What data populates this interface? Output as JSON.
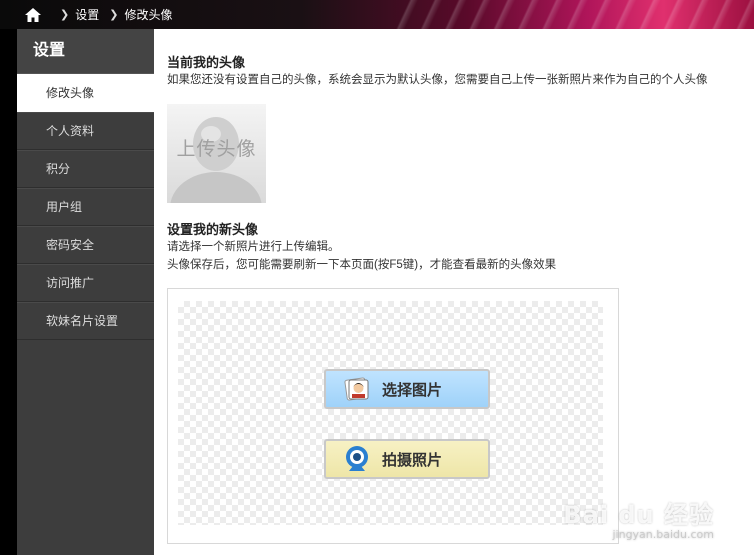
{
  "breadcrumb": {
    "items": [
      "设置",
      "修改头像"
    ]
  },
  "sidebar": {
    "title": "设置",
    "items": [
      {
        "label": "修改头像",
        "active": true
      },
      {
        "label": "个人资料",
        "active": false
      },
      {
        "label": "积分",
        "active": false
      },
      {
        "label": "用户组",
        "active": false
      },
      {
        "label": "密码安全",
        "active": false
      },
      {
        "label": "访问推广",
        "active": false
      },
      {
        "label": "软妹名片设置",
        "active": false
      }
    ]
  },
  "current_avatar": {
    "heading": "当前我的头像",
    "description": "如果您还没有设置自己的头像，系统会显示为默认头像，您需要自己上传一张新照片来作为自己的个人头像",
    "placeholder_label": "上传头像"
  },
  "new_avatar": {
    "heading": "设置我的新头像",
    "line1": "请选择一个新照片进行上传编辑。",
    "line2": "头像保存后，您可能需要刷新一下本页面(按F5键)，才能查看最新的头像效果",
    "choose_button": "选择图片",
    "capture_button": "拍摄照片"
  },
  "watermark": {
    "main": "Bai du 经验",
    "sub": "jingyan.baidu.com"
  },
  "colors": {
    "sidebar_bg": "#3d3d3d",
    "choose_btn": "#a8d7fb",
    "capture_btn": "#f1eab2",
    "topbar_accent": "#e0306e"
  }
}
